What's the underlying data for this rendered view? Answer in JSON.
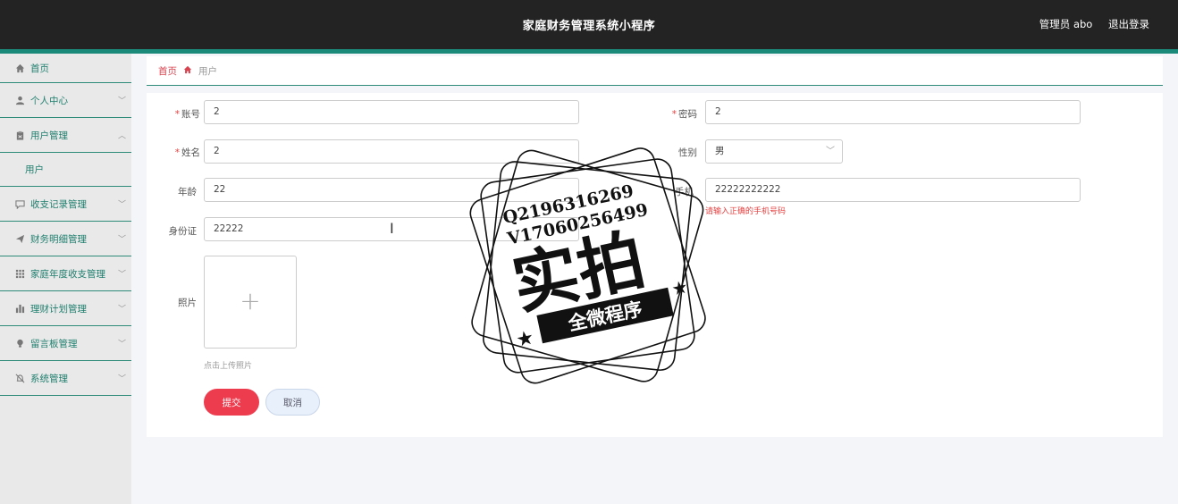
{
  "header": {
    "title": "家庭财务管理系统小程序",
    "user_label": "管理员 abo",
    "logout_label": "退出登录"
  },
  "sidebar": {
    "items": [
      {
        "label": "首页",
        "icon": "home-icon"
      },
      {
        "label": "个人中心",
        "icon": "person-icon"
      },
      {
        "label": "用户管理",
        "icon": "clipboard-icon"
      },
      {
        "label": "用户",
        "icon": ""
      },
      {
        "label": "收支记录管理",
        "icon": "chat-icon"
      },
      {
        "label": "财务明细管理",
        "icon": "send-icon"
      },
      {
        "label": "家庭年度收支管理",
        "icon": "grid-icon"
      },
      {
        "label": "理财计划管理",
        "icon": "bar-chart-icon"
      },
      {
        "label": "留言板管理",
        "icon": "bulb-icon"
      },
      {
        "label": "系统管理",
        "icon": "bell-off-icon"
      }
    ]
  },
  "breadcrumb": {
    "home": "首页",
    "current": "用户"
  },
  "form": {
    "account": {
      "label": "账号",
      "value": "2"
    },
    "password": {
      "label": "密码",
      "value": "2"
    },
    "name": {
      "label": "姓名",
      "value": "2"
    },
    "gender": {
      "label": "性别",
      "value": "男"
    },
    "age": {
      "label": "年龄",
      "value": "22"
    },
    "phone": {
      "label": "手机",
      "value": "22222222222",
      "error": "请输入正确的手机号码"
    },
    "id_card": {
      "label": "身份证",
      "value": "22222"
    },
    "photo": {
      "label": "照片",
      "tip": "点击上传照片"
    },
    "submit_label": "提交",
    "cancel_label": "取消"
  },
  "watermark": {
    "line1": "Q2196316269",
    "line2": "V17060256499",
    "main": "实拍",
    "banner": "全微程序"
  },
  "colors": {
    "topbar": "#232323",
    "accent": "#1b8a7a",
    "sidebar_text": "#1f7f6e",
    "submit": "#ee3c4f",
    "error": "#e64242"
  }
}
